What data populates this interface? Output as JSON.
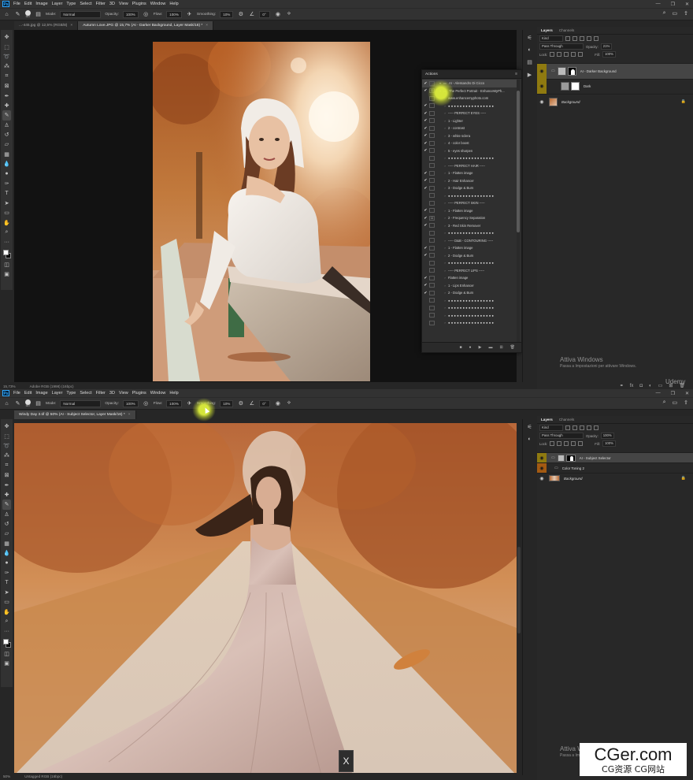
{
  "app": {
    "logo": "Ps"
  },
  "menus": [
    "File",
    "Edit",
    "Image",
    "Layer",
    "Type",
    "Select",
    "Filter",
    "3D",
    "View",
    "Plugins",
    "Window",
    "Help"
  ],
  "top": {
    "tabs": [
      {
        "label": "...-445.jpg @ 12,5% (RGB/8)",
        "active": false
      },
      {
        "label": "Autumn Love.JPG @ 15,7% (AI - Darker Background, Layer Mask/16) *",
        "active": true
      }
    ],
    "options": {
      "brush_size": "587",
      "mode_label": "Mode:",
      "mode": "Normal",
      "opacity_label": "Opacity:",
      "opacity": "100%",
      "flow_label": "Flow:",
      "flow": "100%",
      "smoothing_label": "Smoothing:",
      "smoothing": "10%",
      "angle": "0°"
    },
    "status": {
      "zoom": "15,73%",
      "profile": "Adobe RGB (1998) (16bpc)"
    },
    "layers": {
      "tabs": [
        "Layers",
        "Channels"
      ],
      "kind": "Kind",
      "blend": "Pass Through",
      "opacity_label": "Opacity:",
      "opacity": "21%",
      "lock_label": "Lock:",
      "fill_label": "Fill:",
      "fill": "100%",
      "items": [
        {
          "name": "AI - Darker Background"
        },
        {
          "name": "Dark"
        },
        {
          "name": "Background"
        }
      ]
    },
    "activate_windows": {
      "title": "Attiva Windows",
      "subtitle": "Passa a Impostazioni per attivare Windows."
    },
    "udemy": "Udemy"
  },
  "actions": {
    "title": "Actions",
    "rows": [
      {
        "check": "✔",
        "dialog": "",
        "text": "AI - Alessandro Di Cicco",
        "level": 0,
        "hl": true
      },
      {
        "check": "✔",
        "dialog": "☐",
        "text": "The Perfect Portrait - EnhanceMyPh...",
        "level": 0,
        "hl": false
      },
      {
        "check": "",
        "dialog": "",
        "text": "www.enhancemyphoto.com",
        "level": 1,
        "hl": false
      },
      {
        "check": "✔",
        "dialog": "",
        "text": "● ● ● ● ● ● ● ● ● ● ● ● ● ● ● ●",
        "level": 1,
        "hl": false
      },
      {
        "check": "✔",
        "dialog": "",
        "text": "----- PERFECT EYES -----",
        "level": 1,
        "hl": false
      },
      {
        "check": "✔",
        "dialog": "",
        "text": "1 - Lighter",
        "level": 1,
        "hl": false
      },
      {
        "check": "✔",
        "dialog": "",
        "text": "2 - contrast",
        "level": 1,
        "hl": false
      },
      {
        "check": "✔",
        "dialog": "",
        "text": "3 - white sclera",
        "level": 1,
        "hl": false
      },
      {
        "check": "✔",
        "dialog": "",
        "text": "4 - color boost",
        "level": 1,
        "hl": false
      },
      {
        "check": "✔",
        "dialog": "",
        "text": "5 - eyes sharpen",
        "level": 1,
        "hl": false
      },
      {
        "check": "",
        "dialog": "",
        "text": "● ● ● ● ● ● ● ● ● ● ● ● ● ● ● ●",
        "level": 1,
        "hl": false
      },
      {
        "check": "",
        "dialog": "",
        "text": "----- PERFECT HAIR -----",
        "level": 1,
        "hl": false
      },
      {
        "check": "✔",
        "dialog": "",
        "text": "1 - Flatten image",
        "level": 1,
        "hl": false
      },
      {
        "check": "✔",
        "dialog": "",
        "text": "2 - Hair Enhancer",
        "level": 1,
        "hl": false
      },
      {
        "check": "✔",
        "dialog": "",
        "text": "3 - Dodge & Burn",
        "level": 1,
        "hl": false
      },
      {
        "check": "",
        "dialog": "",
        "text": "● ● ● ● ● ● ● ● ● ● ● ● ● ● ● ●",
        "level": 1,
        "hl": false
      },
      {
        "check": "",
        "dialog": "",
        "text": "----- PERFECT SKIN -----",
        "level": 1,
        "hl": false
      },
      {
        "check": "✔",
        "dialog": "",
        "text": "1 - Flatten image",
        "level": 1,
        "hl": false
      },
      {
        "check": "✔",
        "dialog": "☐",
        "text": "2 - Frequency Separation",
        "level": 1,
        "hl": false
      },
      {
        "check": "✔",
        "dialog": "",
        "text": "3 - Red Skin Remover",
        "level": 1,
        "hl": false
      },
      {
        "check": "",
        "dialog": "",
        "text": "● ● ● ● ● ● ● ● ● ● ● ● ● ● ● ●",
        "level": 1,
        "hl": false
      },
      {
        "check": "",
        "dialog": "",
        "text": "----- D&B - CONTOURING -----",
        "level": 1,
        "hl": false
      },
      {
        "check": "✔",
        "dialog": "",
        "text": "1 - Flatten image",
        "level": 1,
        "hl": false
      },
      {
        "check": "✔",
        "dialog": "",
        "text": "2 - Dodge & Burn",
        "level": 1,
        "hl": false
      },
      {
        "check": "",
        "dialog": "",
        "text": "● ● ● ● ● ● ● ● ● ● ● ● ● ● ● ●",
        "level": 1,
        "hl": false
      },
      {
        "check": "",
        "dialog": "",
        "text": "----- PERFECT LIPS -----",
        "level": 1,
        "hl": false
      },
      {
        "check": "✔",
        "dialog": "",
        "text": "Flatten image",
        "level": 1,
        "hl": false
      },
      {
        "check": "✔",
        "dialog": "",
        "text": "1 - Lips Enhancer",
        "level": 1,
        "hl": false
      },
      {
        "check": "✔",
        "dialog": "",
        "text": "2 - Dodge & Burn",
        "level": 1,
        "hl": false
      },
      {
        "check": "",
        "dialog": "",
        "text": "● ● ● ● ● ● ● ● ● ● ● ● ● ● ● ●",
        "level": 1,
        "hl": false
      },
      {
        "check": "",
        "dialog": "",
        "text": "● ● ● ● ● ● ● ● ● ● ● ● ● ● ● ●",
        "level": 1,
        "hl": false
      },
      {
        "check": "",
        "dialog": "",
        "text": "● ● ● ● ● ● ● ● ● ● ● ● ● ● ● ●",
        "level": 1,
        "hl": false
      },
      {
        "check": "",
        "dialog": "",
        "text": "● ● ● ● ● ● ● ● ● ● ● ● ● ● ● ●",
        "level": 1,
        "hl": false
      }
    ]
  },
  "bottom": {
    "tabs": [
      {
        "label": "Windy Day 3.tif @ 50% (AI - Subject Selector, Layer Mask/16) *",
        "active": true
      }
    ],
    "options": {
      "brush_size": "587",
      "mode_label": "Mode:",
      "mode": "Normal",
      "opacity_label": "Opacity:",
      "opacity": "100%",
      "flow_label": "Flow:",
      "flow": "100%",
      "smoothing_label": "Smoothing:",
      "smoothing": "10%",
      "angle": "0°"
    },
    "status": {
      "zoom": "50%",
      "profile": "Untagged RGB (16bpc)"
    },
    "layers": {
      "tabs": [
        "Layers",
        "Channels"
      ],
      "kind": "Kind",
      "blend": "Pass Through",
      "opacity_label": "Opacity:",
      "opacity": "100%",
      "lock_label": "Lock:",
      "fill_label": "Fill:",
      "fill": "100%",
      "items": [
        {
          "name": "AI - Subject Selector"
        },
        {
          "name": "Color Toning 2"
        },
        {
          "name": "Background"
        }
      ]
    },
    "activate_windows": {
      "title": "Attiva Windows",
      "subtitle": "Passa a Impostazioni per attivare Windows."
    }
  },
  "overlay": {
    "close_label": "X",
    "site": "CGer.com",
    "site_sub": "CG资源 CG网站"
  },
  "colors": {
    "accent_yellow": "#8f7a10",
    "accent_orange": "#a35a12",
    "panel": "#282828",
    "highlight": "#dff03c"
  }
}
